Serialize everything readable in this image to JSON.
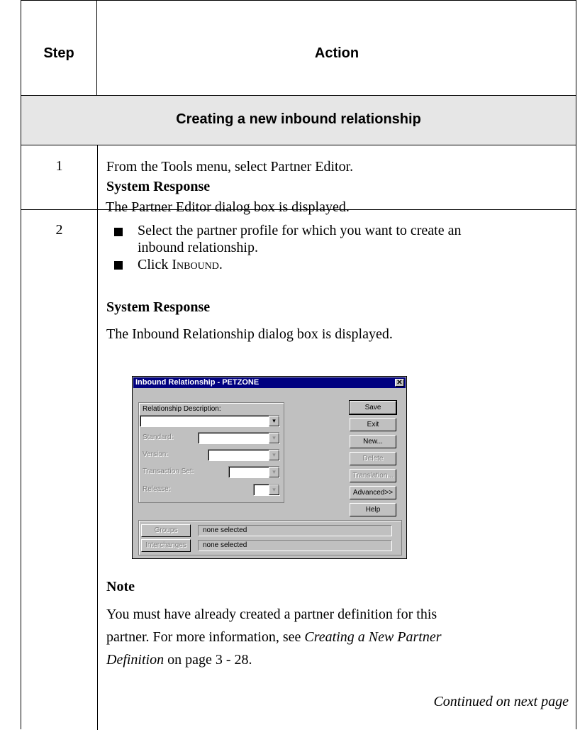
{
  "header": {
    "step": "Step",
    "action": "Action"
  },
  "section_title": "Creating a new inbound relationship",
  "steps": [
    {
      "number": "1",
      "instruction": "From the Tools menu, select Partner Editor.",
      "response_heading": "System Response",
      "response": "The Partner Editor dialog box is displayed."
    },
    {
      "number": "2",
      "bullet1_line1": "Select the partner profile for which you want to create an",
      "bullet1_line2": "inbound relationship.",
      "bullet2_prefix": "Click ",
      "bullet2_button": "Inbound",
      "bullet2_suffix": ".",
      "response_heading": "System Response",
      "response": "The Inbound Relationship dialog box is displayed.",
      "note_heading": "Note",
      "note_line1": "You must have already created a partner definition for this",
      "note_line2_a": "partner. For more information, see ",
      "note_line2_ref": "Creating a New Partner",
      "note_line3_ref": "Definition",
      "note_line3_b": " on page 3 - 28."
    }
  ],
  "continued": "Continued on next page",
  "dialog": {
    "title": "Inbound Relationship - PETZONE",
    "close_glyph": "✕",
    "relationship_description_label": "Relationship Description:",
    "standard_label": "Standard:",
    "version_label": "Version:",
    "transaction_set_label": "Transaction Set:",
    "release_label": "Release:",
    "buttons": {
      "save": "Save",
      "exit": "Exit",
      "new": "New...",
      "delete": "Delete",
      "translation": "Translation...",
      "advanced": "Advanced>>",
      "help": "Help",
      "groups": "Groups",
      "interchanges": "Interchanges"
    },
    "groups_status": "none selected",
    "interchanges_status": "none selected",
    "dropdown_icon": "arrow-down-icon",
    "dropdown_glyph": "▾"
  },
  "colors": {
    "section_bg": "#e6e6e6",
    "dialog_title_bg": "#000080",
    "dialog_face": "#c0c0c0"
  }
}
